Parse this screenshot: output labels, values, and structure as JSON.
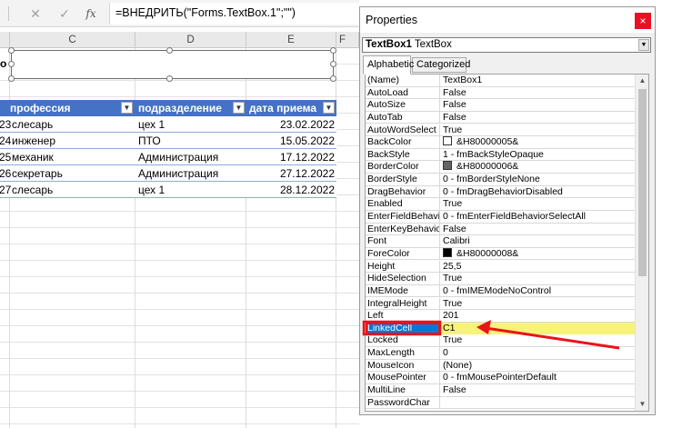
{
  "formula_bar": {
    "cancel_glyph": "✕",
    "enter_glyph": "✓",
    "fx_label": "fx",
    "formula": "=ВНЕДРИТЬ(\"Forms.TextBox.1\";\"\")"
  },
  "columns": [
    "C",
    "D",
    "E",
    "F"
  ],
  "textbox_edge_letter": "о",
  "table": {
    "headers": [
      "профессия",
      "подразделение",
      "дата приема"
    ],
    "rows": [
      {
        "num": "23",
        "profession": "слесарь",
        "department": "цех 1",
        "date": "23.02.2022"
      },
      {
        "num": "24",
        "profession": "инженер",
        "department": "ПТО",
        "date": "15.05.2022"
      },
      {
        "num": "25",
        "profession": "механик",
        "department": "Администрация",
        "date": "17.12.2022"
      },
      {
        "num": "26",
        "profession": "секретарь",
        "department": "Администрация",
        "date": "27.12.2022"
      },
      {
        "num": "27",
        "profession": "слесарь",
        "department": "цех 1",
        "date": "28.12.2022"
      }
    ]
  },
  "properties": {
    "title": "Properties",
    "close_glyph": "×",
    "object_name": "TextBox1",
    "object_type": "TextBox",
    "tabs": [
      "Alphabetic",
      "Categorized"
    ],
    "rows": [
      {
        "name": "(Name)",
        "value": "TextBox1"
      },
      {
        "name": "AutoLoad",
        "value": "False"
      },
      {
        "name": "AutoSize",
        "value": "False"
      },
      {
        "name": "AutoTab",
        "value": "False"
      },
      {
        "name": "AutoWordSelect",
        "value": "True"
      },
      {
        "name": "BackColor",
        "value": "&H80000005&",
        "swatch": "#ffffff"
      },
      {
        "name": "BackStyle",
        "value": "1 - fmBackStyleOpaque"
      },
      {
        "name": "BorderColor",
        "value": "&H80000006&",
        "swatch": "#646464"
      },
      {
        "name": "BorderStyle",
        "value": "0 - fmBorderStyleNone"
      },
      {
        "name": "DragBehavior",
        "value": "0 - fmDragBehaviorDisabled"
      },
      {
        "name": "Enabled",
        "value": "True"
      },
      {
        "name": "EnterFieldBehavior",
        "value": "0 - fmEnterFieldBehaviorSelectAll"
      },
      {
        "name": "EnterKeyBehavior",
        "value": "False"
      },
      {
        "name": "Font",
        "value": "Calibri"
      },
      {
        "name": "ForeColor",
        "value": "&H80000008&",
        "swatch": "#000000"
      },
      {
        "name": "Height",
        "value": "25,5"
      },
      {
        "name": "HideSelection",
        "value": "True"
      },
      {
        "name": "IMEMode",
        "value": "0 - fmIMEModeNoControl"
      },
      {
        "name": "IntegralHeight",
        "value": "True"
      },
      {
        "name": "Left",
        "value": "201"
      },
      {
        "name": "LinkedCell",
        "value": "C1",
        "selected": true
      },
      {
        "name": "Locked",
        "value": "True"
      },
      {
        "name": "MaxLength",
        "value": "0"
      },
      {
        "name": "MouseIcon",
        "value": "(None)"
      },
      {
        "name": "MousePointer",
        "value": "0 - fmMousePointerDefault"
      },
      {
        "name": "MultiLine",
        "value": "False"
      },
      {
        "name": "PasswordChar",
        "value": ""
      }
    ]
  },
  "colors": {
    "table_header": "#4472c4",
    "selection": "#0078d7",
    "highlight_value": "#f7f27a",
    "annotation_red": "#e8141b",
    "close_button": "#e81123"
  }
}
